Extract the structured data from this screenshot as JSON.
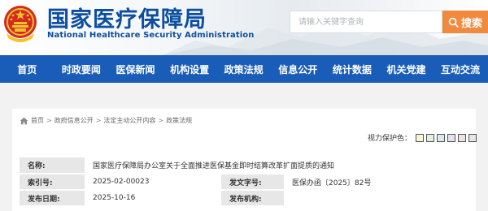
{
  "header": {
    "title_cn": "国家医疗保障局",
    "title_en": "National Healthcare Security Administration",
    "search": {
      "placeholder": "请输入关键字查询",
      "button_label": "搜索"
    }
  },
  "nav": {
    "items": [
      {
        "label": "首页"
      },
      {
        "label": "时政要闻"
      },
      {
        "label": "医保新闻"
      },
      {
        "label": "机构设置"
      },
      {
        "label": "政策法规"
      },
      {
        "label": "信息公开"
      },
      {
        "label": "统计数据"
      },
      {
        "label": "机关党建"
      },
      {
        "label": "互动交流"
      }
    ]
  },
  "breadcrumb": {
    "items": [
      "首页",
      "政府信息公开",
      "法定主动公开内容",
      "政策法规"
    ],
    "separator": ">"
  },
  "vision": {
    "label": "视力保护色：",
    "swatches": [
      "#f7f6d4",
      "#dff0e0",
      "#dbe8f4",
      "#e6e0ef",
      "#f1e2e2",
      "#e6e6e6"
    ]
  },
  "doc_info": {
    "name_label": "名称:",
    "name_value": "国家医疗保障局办公室关于全面推进医保基金即时结算改革扩面提质的通知",
    "index_label": "索引号:",
    "index_value": "2025-02-00023",
    "docno_label": "发文字号:",
    "docno_value": "医保办函〔2025〕82号",
    "date_label": "发布日期:",
    "date_value": "2025-10-16",
    "org_label": "发布机构:",
    "org_value": ""
  },
  "colors": {
    "brand_blue": "#0b4ea2",
    "nav_blue": "#1a5db8",
    "search_orange": "#f08a3e",
    "label_gray": "#e7e7e7"
  }
}
